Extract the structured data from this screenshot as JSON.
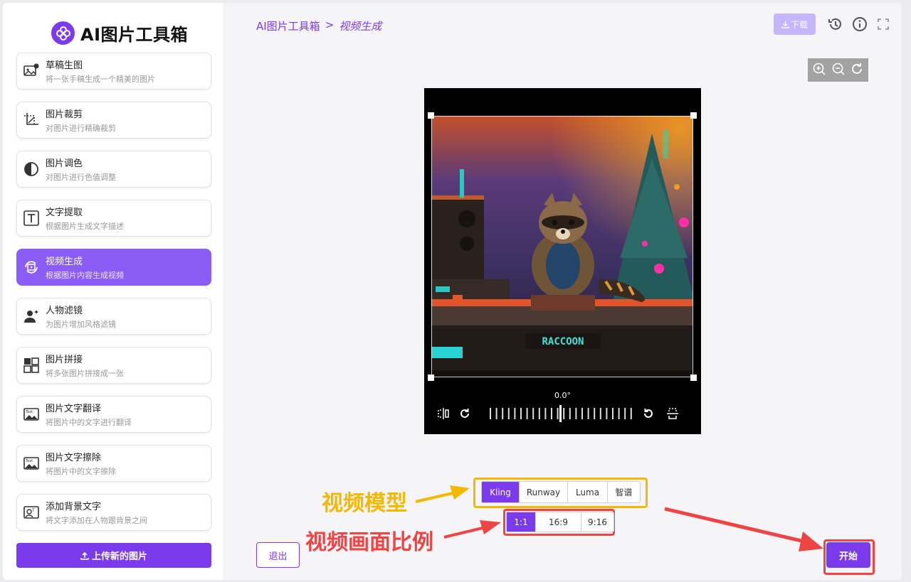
{
  "app": {
    "title": "AI图片工具箱"
  },
  "sidebar": {
    "items": [
      {
        "title": "草稿生图",
        "desc": "将一张手稿生成一个精美的图片"
      },
      {
        "title": "图片裁剪",
        "desc": "对图片进行精确裁剪"
      },
      {
        "title": "图片调色",
        "desc": "对图片进行色值调整"
      },
      {
        "title": "文字提取",
        "desc": "根据图片生成文字描述"
      },
      {
        "title": "视频生成",
        "desc": "根据图片内容生成视频"
      },
      {
        "title": "人物滤镜",
        "desc": "为图片增加风格滤镜"
      },
      {
        "title": "图片拼接",
        "desc": "将多张图片拼接成一张"
      },
      {
        "title": "图片文字翻译",
        "desc": "将图片中的文字进行翻译"
      },
      {
        "title": "图片文字擦除",
        "desc": "将图片中的文字擦除"
      },
      {
        "title": "添加背景文字",
        "desc": "将文字添加在人物跟背景之间"
      }
    ],
    "active_index": 4,
    "upload_label": "上传新的图片"
  },
  "header": {
    "breadcrumb_root": "AI图片工具箱",
    "breadcrumb_sep": ">",
    "breadcrumb_current": "视频生成",
    "download_label": "下载"
  },
  "editor": {
    "rotation": "0.0°",
    "image_sign_text": "RACCOON"
  },
  "video": {
    "models": [
      "Kling",
      "Runway",
      "Luma",
      "智谱"
    ],
    "selected_model": "Kling",
    "ratios": [
      "1:1",
      "16:9",
      "9:16"
    ],
    "selected_ratio": "1:1"
  },
  "actions": {
    "exit_label": "退出",
    "start_label": "开始"
  },
  "annotations": {
    "model": "视频模型",
    "ratio": "视频画面比例"
  },
  "colors": {
    "accent": "#7c3aed",
    "annotation_yellow": "#f5b800",
    "annotation_red": "#ef4444"
  }
}
